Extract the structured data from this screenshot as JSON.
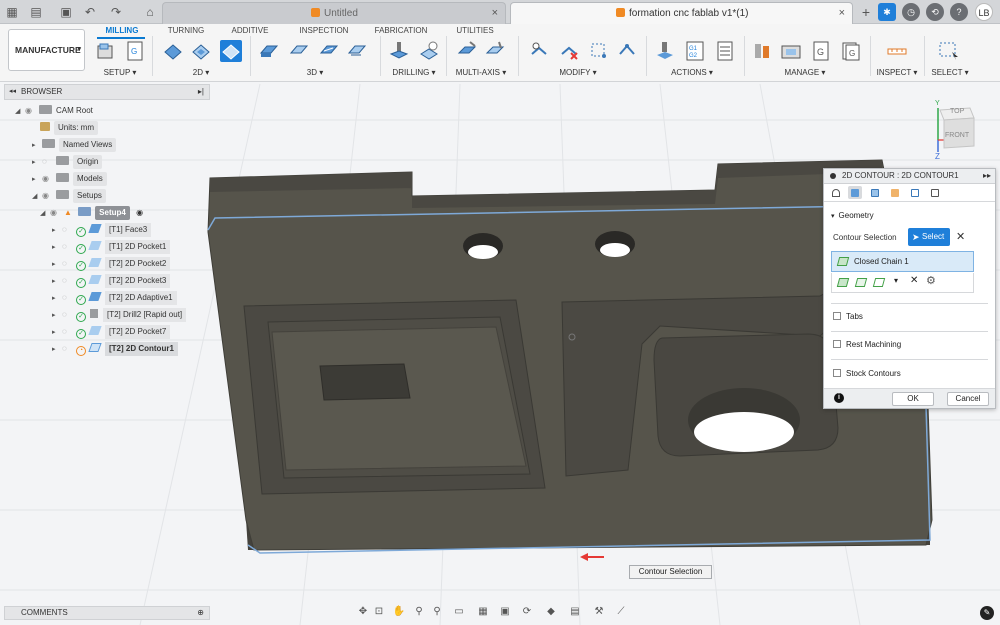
{
  "tabbar": {
    "doc_tabs": [
      {
        "title": "Untitled",
        "active": false
      },
      {
        "title": "formation cnc fablab v1*(1)",
        "active": true
      }
    ],
    "user_initials": "LB",
    "close_glyph": "×",
    "new_tab_glyph": "+"
  },
  "toolbar": {
    "workspace": "MANUFACTURE",
    "tabs": [
      "MILLING",
      "TURNING",
      "ADDITIVE",
      "INSPECTION",
      "FABRICATION",
      "UTILITIES"
    ],
    "active_tab": "MILLING",
    "groups": [
      "SETUP",
      "2D",
      "3D",
      "DRILLING",
      "MULTI-AXIS",
      "MODIFY",
      "ACTIONS",
      "MANAGE",
      "INSPECT",
      "SELECT"
    ],
    "accent_color": "#0b7ad1"
  },
  "browser": {
    "title": "BROWSER",
    "items": [
      {
        "label": "CAM Root"
      },
      {
        "label": "Units: mm"
      },
      {
        "label": "Named Views"
      },
      {
        "label": "Origin"
      },
      {
        "label": "Models"
      },
      {
        "label": "Setups"
      },
      {
        "label": "Setup4"
      }
    ],
    "operations": [
      {
        "label": "[T1] Face3"
      },
      {
        "label": "[T1] 2D Pocket1"
      },
      {
        "label": "[T2] 2D Pocket2"
      },
      {
        "label": "[T2] 2D Pocket3"
      },
      {
        "label": "[T2] 2D Adaptive1"
      },
      {
        "label": "[T2] Drill2 [Rapid out]"
      },
      {
        "label": "[T2] 2D Pocket7"
      },
      {
        "label": "[T2] 2D Contour1"
      }
    ]
  },
  "comments": {
    "title": "COMMENTS"
  },
  "viewcube": {
    "top": "TOP",
    "front": "FRONT",
    "axis_x": "X",
    "axis_y": "Y",
    "axis_z": "Z"
  },
  "panel": {
    "title": "2D CONTOUR : 2D CONTOUR1",
    "section": "Geometry",
    "contour_label": "Contour Selection",
    "select_label": "Select",
    "chain_label": "Closed Chain 1",
    "tabs_label": "Tabs",
    "rest_label": "Rest Machining",
    "stock_label": "Stock Contours",
    "ok_label": "OK",
    "cancel_label": "Cancel"
  },
  "tooltip": "Contour Selection",
  "model_color": "#56544b"
}
